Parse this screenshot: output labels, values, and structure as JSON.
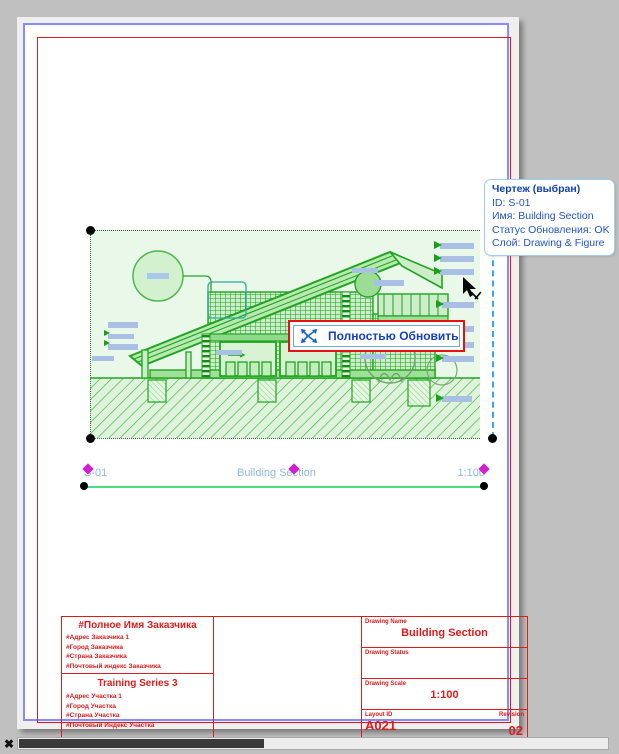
{
  "app": {
    "background_color": "#c0c0c0",
    "page_border_color": "#8a8aff",
    "drawing_border_color": "#e01b1b"
  },
  "drawing": {
    "id": "S-01",
    "name": "Building Section",
    "scale": "1:100",
    "selection_handle_color": "#000000",
    "viewport_fill": "#e9f8e9",
    "line_color": "#1fa61f"
  },
  "tooltip": {
    "title": "Чертеж (выбран)",
    "id_line": "ID: S-01",
    "name_line": "Имя: Building Section",
    "update_status_line": "Статус Обновления: OK",
    "layer_line": "Слой: Drawing & Figure",
    "text_color": "#2255cc",
    "border_color": "#9fd0ee"
  },
  "context_menu": {
    "icon": "refresh-all-arrows-icon",
    "label": "Полностью Обновить",
    "border_color": "#e81010",
    "text_color": "#1540cc"
  },
  "cursor": {
    "icon": "arrow-move-cursor"
  },
  "title_block": {
    "client": {
      "name": "#Полное Имя Заказчика",
      "lines": [
        "#Адрес Заказчика 1",
        "#Город Заказчика",
        "#Страна Заказчика",
        "#Почтовый индекс Заказчика"
      ]
    },
    "project": {
      "name": "Training Series 3",
      "lines": [
        "#Адрес Участка 1",
        "#Город Участка",
        "#Страна Участка",
        "#Почтовый Индекс Участка"
      ]
    },
    "fields": [
      {
        "caption": "Drawing Name",
        "value": "Building Section"
      },
      {
        "caption": "Drawing Status",
        "value": ""
      },
      {
        "caption": "Drawing Scale",
        "value": "1:100"
      }
    ],
    "layout": {
      "id_caption": "Layout ID",
      "id_value": "A021",
      "revision_caption": "Revision",
      "revision_value": "02"
    },
    "color": "#e01b1b"
  },
  "scrollbar": {
    "close_glyph": "✖"
  }
}
